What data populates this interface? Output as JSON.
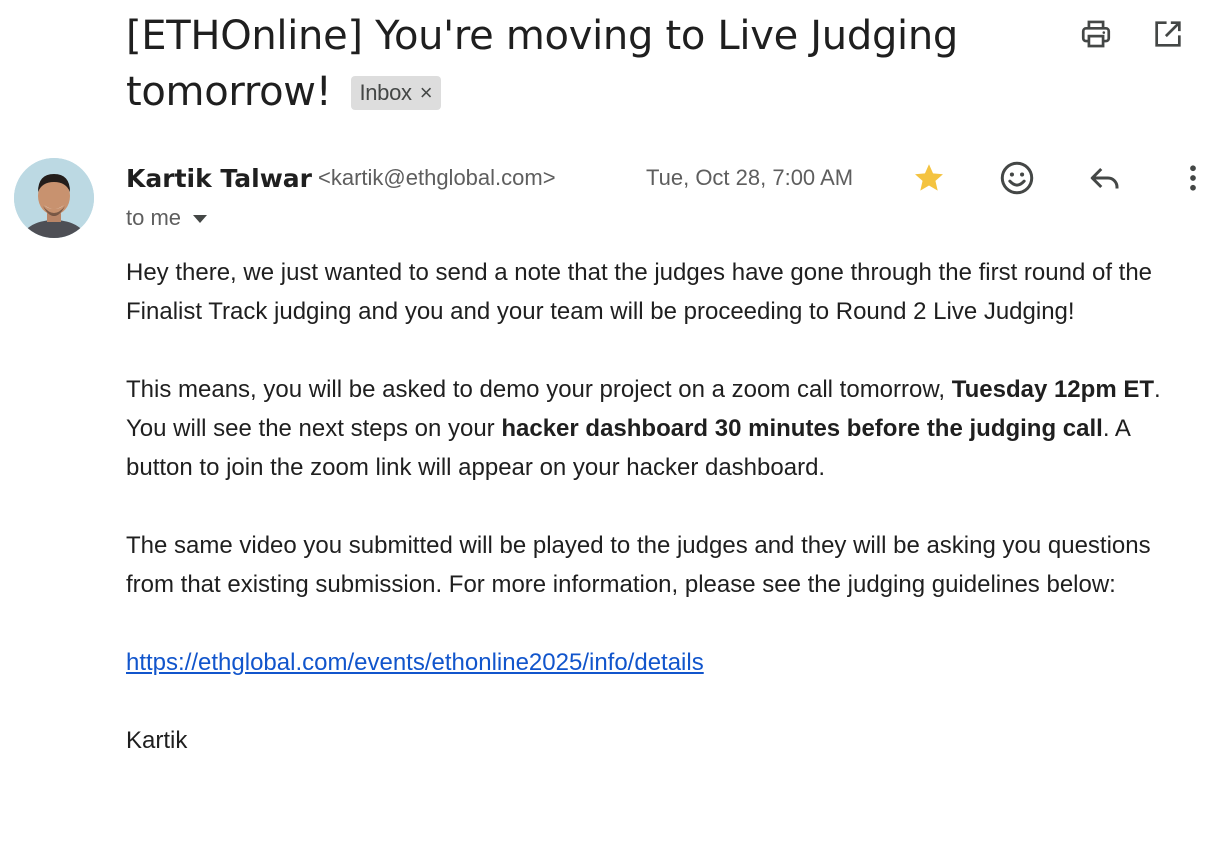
{
  "email": {
    "subject_line1": "[ETHOnline] You're moving to Live Judging",
    "subject_line2": "tomorrow!",
    "label": "Inbox",
    "label_remove": "×",
    "sender_name": "Kartik Talwar",
    "sender_email": "<kartik@ethglobal.com>",
    "date": "Tue, Oct 28, 7:00 AM",
    "recipient": "to me",
    "starred": true,
    "star_color": "#f4c340",
    "body": {
      "p1": "Hey there, we just wanted to send a note that the judges have gone through the first round of the Finalist Track judging and you and your team will be proceeding to Round 2 Live Judging!",
      "p2_a": "This means, you will be asked to demo your project on a zoom call tomorrow, ",
      "p2_b": "Tuesday 12pm ET",
      "p2_c": ". You will see the next steps on your ",
      "p2_d": "hacker dashboard 30 minutes before the judging call",
      "p2_e": ". A button to join the zoom link will appear on your hacker dashboard.",
      "p3": "The same video you submitted will be played to the judges and they will be asking you questions from that existing submission. For more information, please see the judging guidelines below:",
      "link": "https://ethglobal.com/events/ethonline2025/info/details",
      "signature": "Kartik"
    }
  },
  "icons": {
    "print": "print-icon",
    "open_new_window": "open-in-new-window-icon",
    "star": "star-icon",
    "emoji": "emoji-icon",
    "reply": "reply-icon",
    "more": "more-vertical-icon"
  },
  "colors": {
    "link": "#1155cc",
    "label_chip_bg": "#dddddd",
    "text": "#1f1f1f",
    "muted": "#5e5e5e"
  }
}
